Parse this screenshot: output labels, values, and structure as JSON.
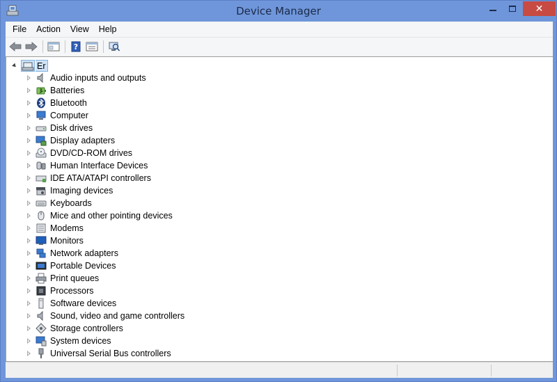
{
  "window": {
    "title": "Device Manager",
    "close_glyph": "✕"
  },
  "menu": [
    "File",
    "Action",
    "View",
    "Help"
  ],
  "toolbar": {
    "buttons": [
      "back-arrow-icon",
      "forward-arrow-icon",
      "show-hide-console-tree-icon",
      "help-icon",
      "properties-icon",
      "scan-hardware-changes-icon"
    ]
  },
  "tree": {
    "root": {
      "label": "Er"
    },
    "categories": [
      {
        "label": "Audio inputs and outputs",
        "icon": "speaker-icon"
      },
      {
        "label": "Batteries",
        "icon": "battery-icon"
      },
      {
        "label": "Bluetooth",
        "icon": "bluetooth-icon"
      },
      {
        "label": "Computer",
        "icon": "computer-icon"
      },
      {
        "label": "Disk drives",
        "icon": "disk-drive-icon"
      },
      {
        "label": "Display adapters",
        "icon": "display-adapter-icon"
      },
      {
        "label": "DVD/CD-ROM drives",
        "icon": "dvd-drive-icon"
      },
      {
        "label": "Human Interface Devices",
        "icon": "hid-icon"
      },
      {
        "label": "IDE ATA/ATAPI controllers",
        "icon": "ide-controller-icon"
      },
      {
        "label": "Imaging devices",
        "icon": "camera-icon"
      },
      {
        "label": "Keyboards",
        "icon": "keyboard-icon"
      },
      {
        "label": "Mice and other pointing devices",
        "icon": "mouse-icon"
      },
      {
        "label": "Modems",
        "icon": "modem-icon"
      },
      {
        "label": "Monitors",
        "icon": "monitor-icon"
      },
      {
        "label": "Network adapters",
        "icon": "network-adapter-icon"
      },
      {
        "label": "Portable Devices",
        "icon": "portable-device-icon"
      },
      {
        "label": "Print queues",
        "icon": "printer-icon"
      },
      {
        "label": "Processors",
        "icon": "processor-icon"
      },
      {
        "label": "Software devices",
        "icon": "software-device-icon"
      },
      {
        "label": "Sound, video and game controllers",
        "icon": "sound-controller-icon"
      },
      {
        "label": "Storage controllers",
        "icon": "storage-controller-icon"
      },
      {
        "label": "System devices",
        "icon": "system-device-icon"
      },
      {
        "label": "Universal Serial Bus controllers",
        "icon": "usb-icon"
      }
    ]
  },
  "colors": {
    "titlebar": "#6f96da",
    "close_button": "#c74b42",
    "selection": "#cfe3f7"
  }
}
